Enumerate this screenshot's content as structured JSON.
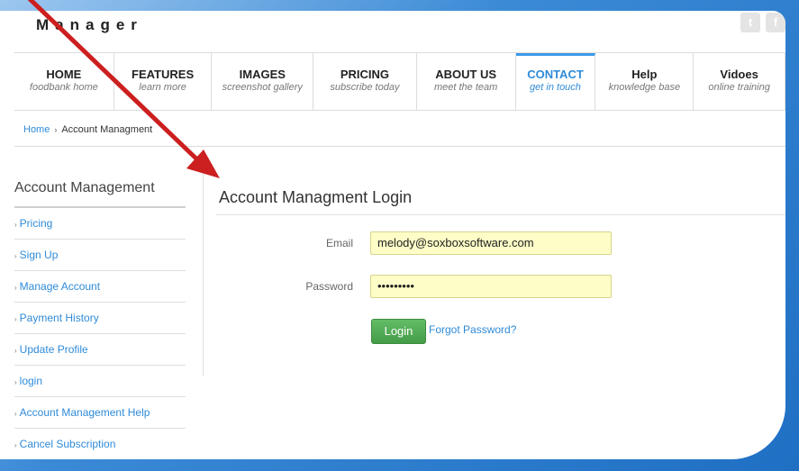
{
  "header": {
    "logo": "Manager",
    "social_icons": [
      "twitter-icon",
      "facebook-icon"
    ]
  },
  "nav": [
    {
      "title": "HOME",
      "subtitle": "foodbank home",
      "width": 112
    },
    {
      "title": "FEATURES",
      "subtitle": "learn more",
      "width": 110
    },
    {
      "title": "IMAGES",
      "subtitle": "screenshot gallery",
      "width": 114
    },
    {
      "title": "PRICING",
      "subtitle": "subscribe today",
      "width": 116
    },
    {
      "title": "ABOUT US",
      "subtitle": "meet the team",
      "width": 111
    },
    {
      "title": "CONTACT",
      "subtitle": "get in touch",
      "width": 90,
      "active": true
    },
    {
      "title": "Help",
      "subtitle": "knowledge base",
      "width": 110
    },
    {
      "title": "Vidoes",
      "subtitle": "online training",
      "width": 103
    }
  ],
  "breadcrumb": {
    "home": "Home",
    "separator": "›",
    "current": "Account Managment"
  },
  "sidebar": {
    "title": "Account Management",
    "items": [
      "Pricing",
      "Sign Up",
      "Manage Account",
      "Payment History",
      "Update Profile",
      "login",
      "Account Management Help",
      "Cancel Subscription"
    ]
  },
  "main": {
    "title": "Account Managment Login",
    "email_label": "Email",
    "email_value": "melody@soxboxsoftware.com",
    "password_label": "Password",
    "password_value": "•••••••••",
    "login_button": "Login",
    "forgot_link": "Forgot Password?"
  },
  "colors": {
    "accent": "#2f8bd8",
    "button_green": "#4fa853",
    "input_bg": "#fefdc7",
    "annotation_arrow": "#cc1f1f"
  }
}
